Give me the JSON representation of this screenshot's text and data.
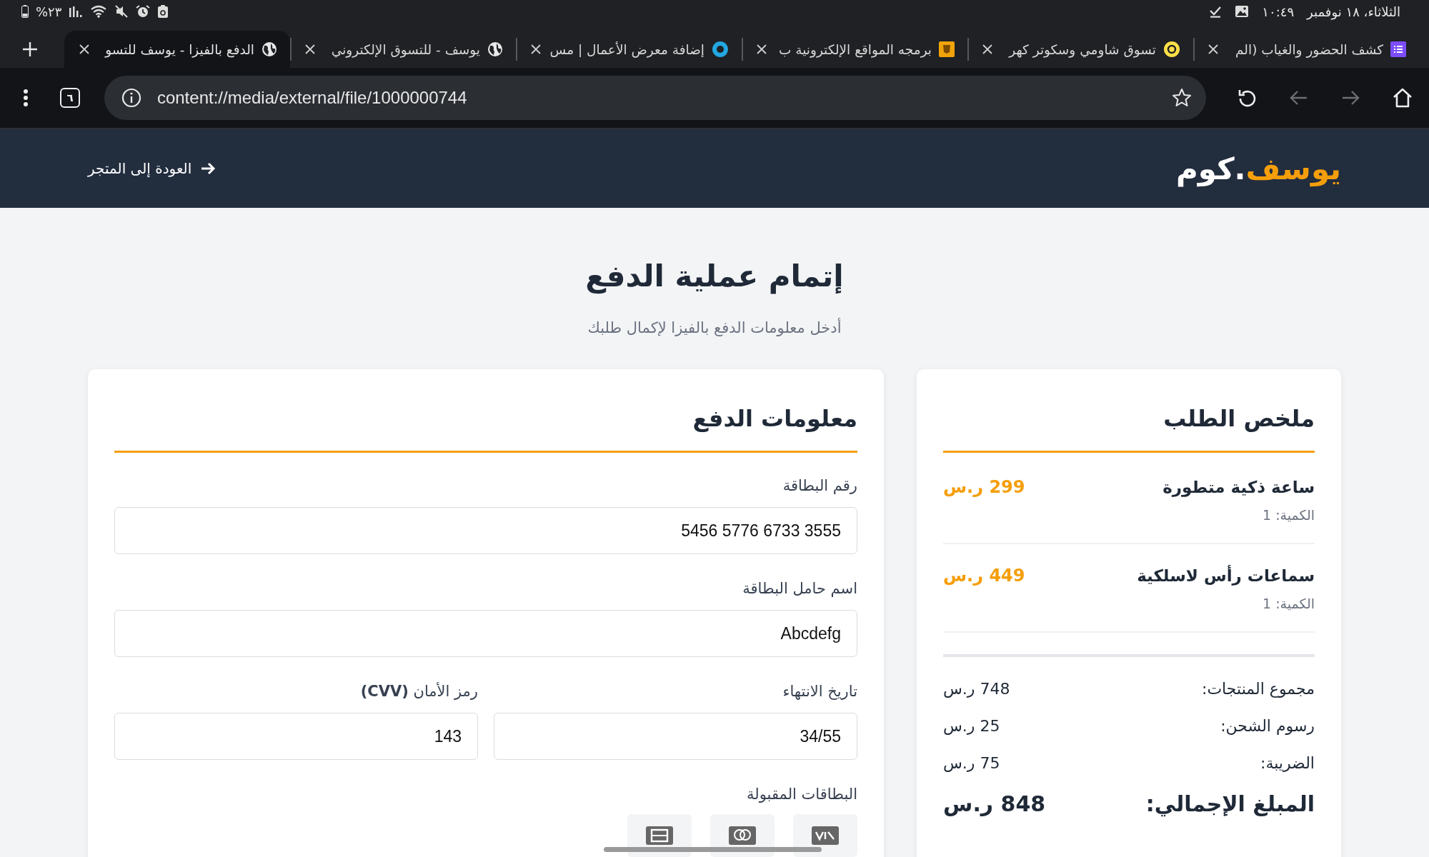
{
  "status_bar": {
    "date": "الثلاثاء، ١٨ نوفمبر",
    "time": "١٠:٤٩",
    "battery": "%٢٣"
  },
  "tabs": [
    {
      "title": "كشف الحضور والغياب (الم",
      "kind": "list",
      "selected": false
    },
    {
      "title": "تسوق شاومي وسكوتر كهر",
      "kind": "coin",
      "selected": false
    },
    {
      "title": "برمجه المواقع الإلكترونية ب",
      "kind": "html",
      "selected": false
    },
    {
      "title": "إضافة معرض الأعمال | مس",
      "kind": "ring",
      "selected": false
    },
    {
      "title": "يوسف - للتسوق الإلكتروني",
      "kind": "globe",
      "selected": false
    },
    {
      "title": "الدفع بالفيزا - يوسف للتسو",
      "kind": "globe",
      "selected": true
    }
  ],
  "toolbar": {
    "tab_count": "٦",
    "url": "content://media/external/file/1000000744",
    "back": {
      "disabled": true
    },
    "forward": {
      "disabled": true
    }
  },
  "site_header": {
    "logo_main": "يوسف",
    "logo_suffix": ".كوم",
    "back_link": "العودة إلى المتجر"
  },
  "page": {
    "title": "إتمام عملية الدفع",
    "subtitle": "أدخل معلومات الدفع بالفيزا لإكمال طلبك"
  },
  "order_summary": {
    "title": "ملخص الطلب",
    "items": [
      {
        "name": "ساعة ذكية متطورة",
        "quantity": "الكمية: 1",
        "price": "299 ر.س"
      },
      {
        "name": "سماعات رأس لاسلكية",
        "quantity": "الكمية: 1",
        "price": "449 ر.س"
      }
    ],
    "rows": [
      {
        "label": "مجموع المنتجات:",
        "value": "748 ر.س"
      },
      {
        "label": "رسوم الشحن:",
        "value": "25 ر.س"
      },
      {
        "label": "الضريبة:",
        "value": "75 ر.س"
      }
    ],
    "total": {
      "label": "المبلغ الإجمالي:",
      "value": "848 ر.س"
    }
  },
  "payment": {
    "title": "معلومات الدفع",
    "fields": [
      {
        "label": "رقم البطاقة",
        "value": "5456 5776 6733 3555"
      },
      {
        "label": "اسم حامل البطاقة",
        "value": "Abcdefg"
      },
      {
        "label": "تاريخ الانتهاء",
        "value": "34/55"
      },
      {
        "label": "رمز الأمان **(CVV)**",
        "value": "143"
      }
    ],
    "accepted_cards_label": "البطاقات المقبولة",
    "cards": [
      {
        "kind": "visa"
      },
      {
        "kind": "mastercard"
      },
      {
        "kind": "amex"
      }
    ]
  }
}
